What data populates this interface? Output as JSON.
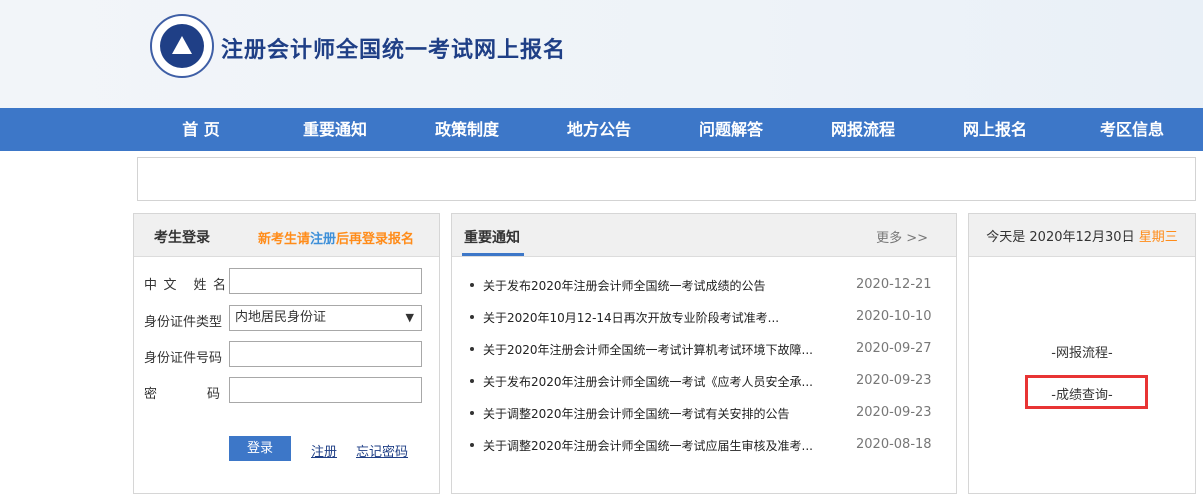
{
  "header": {
    "title": "注册会计师全国统一考试网上报名"
  },
  "nav": {
    "items": [
      "首 页",
      "重要通知",
      "政策制度",
      "地方公告",
      "问题解答",
      "网报流程",
      "网上报名",
      "考区信息"
    ]
  },
  "login": {
    "title": "考生登录",
    "hint_pre": "新考生请",
    "hint_link": "注册",
    "hint_post": "后再登录报名",
    "name_label": "中文 姓名",
    "idtype_label": "身份证件类型",
    "idtype_value": "内地居民身份证",
    "idno_label": "身份证件号码",
    "pwd_label": "密 码",
    "login_button": "登录",
    "register_link": "注册",
    "forgot_link": "忘记密码"
  },
  "notices": {
    "title": "重要通知",
    "more": "更多 >>",
    "items": [
      {
        "title": "关于发布2020年注册会计师全国统一考试成绩的公告",
        "date": "2020-12-21"
      },
      {
        "title": "关于2020年10月12-14日再次开放专业阶段考试准考...",
        "date": "2020-10-10"
      },
      {
        "title": "关于2020年注册会计师全国统一考试计算机考试环境下故障...",
        "date": "2020-09-27"
      },
      {
        "title": "关于发布2020年注册会计师全国统一考试《应考人员安全承...",
        "date": "2020-09-23"
      },
      {
        "title": "关于调整2020年注册会计师全国统一考试有关安排的公告",
        "date": "2020-09-23"
      },
      {
        "title": "关于调整2020年注册会计师全国统一考试应届生审核及准考...",
        "date": "2020-08-18"
      }
    ]
  },
  "side": {
    "date_pre": "今天是 2020年12月30日",
    "weekday": "星期三",
    "flow_link": "-网报流程-",
    "score_link": "-成绩查询-"
  },
  "colors": {
    "nav_bg": "#3d77c8",
    "accent_orange": "#ff8c1a",
    "highlight_red": "#e83434",
    "title_blue": "#1f3f86"
  }
}
